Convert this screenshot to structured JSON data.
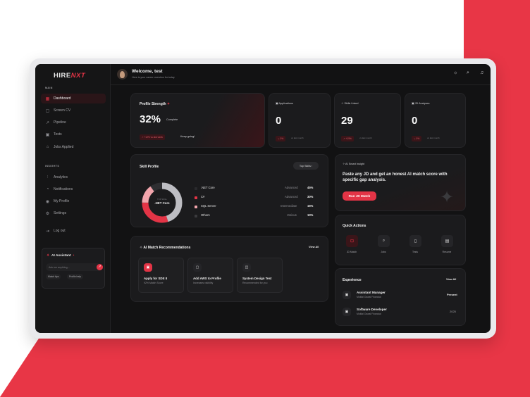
{
  "brand": {
    "logo_a": "HIRE",
    "logo_b": "NXT",
    "accent": "#e33446"
  },
  "header": {
    "welcome": "Welcome, test",
    "subtitle": "Here is your career overview for today"
  },
  "sidebar": {
    "section_main": "MAIN",
    "section_insights": "INSIGHTS",
    "items": [
      {
        "label": "Dashboard",
        "icon": "grid-icon"
      },
      {
        "label": "Screen CV",
        "icon": "document-icon"
      },
      {
        "label": "Pipeline",
        "icon": "trend-icon"
      },
      {
        "label": "Tests",
        "icon": "clipboard-icon"
      },
      {
        "label": "Jobs Applied",
        "icon": "bank-icon"
      },
      {
        "label": "Analytics",
        "icon": "bars-icon"
      },
      {
        "label": "Notifications",
        "icon": "bell-icon"
      },
      {
        "label": "My Profile",
        "icon": "user-icon"
      },
      {
        "label": "Settings",
        "icon": "gear-icon"
      },
      {
        "label": "Log out",
        "icon": "logout-icon"
      }
    ],
    "assistant": {
      "title": "AI Assistant",
      "placeholder": "Ask me anything...",
      "chip_a": "Match tips",
      "chip_b": "Profile help"
    }
  },
  "profile": {
    "title": "Profile Strength",
    "percent": "32%",
    "complete": "Complete",
    "delta": "↗ +12% vs last week",
    "note": "Keep going!"
  },
  "stats": [
    {
      "label": "Applications",
      "value": "0",
      "pill": "↘ 0%",
      "note": "vs last month"
    },
    {
      "label": "Skills Listed",
      "value": "29",
      "pill": "↗ +19%",
      "note": "vs last month"
    },
    {
      "label": "JD Analyses",
      "value": "0",
      "pill": "↘ 0%",
      "note": "vs last month"
    }
  ],
  "skill": {
    "title": "Skill Profile",
    "button": "Top Skills",
    "donut_top": "TOP SKILL",
    "donut_label": ".NET Core",
    "rows": [
      {
        "name": ".NET Core",
        "level": "Advanced",
        "pct": "45%",
        "color": "#2a2a2d"
      },
      {
        "name": "C#",
        "level": "Advanced",
        "pct": "30%",
        "color": "#e33446"
      },
      {
        "name": "SQL Server",
        "level": "Intermediate",
        "pct": "15%",
        "color": "#f2a5ac"
      },
      {
        "name": "Others",
        "level": "Various",
        "pct": "10%",
        "color": "#3a3a3d"
      }
    ]
  },
  "insight": {
    "label": "AI Smart Insight",
    "text": "Paste any JD and get an honest AI match score with specific gap analysis.",
    "button": "Run JD Match"
  },
  "quick": {
    "title": "Quick Actions",
    "items": [
      "JD Match",
      "Jobs",
      "Tests",
      "Resume"
    ]
  },
  "recs": {
    "title": "AI Match Recommendations",
    "view_all": "View All",
    "items": [
      {
        "title": "Apply for SDE II",
        "sub": "92% Match Score"
      },
      {
        "title": "Add AWS to Profile",
        "sub": "Increases visibility"
      },
      {
        "title": "System Design Test",
        "sub": "Recommended for you"
      }
    ]
  },
  "experience": {
    "title": "Experience",
    "view_all": "View All",
    "items": [
      {
        "role": "Assistant Manager",
        "company": "Motilal Oswal Financial",
        "when": "Present"
      },
      {
        "role": "Software Developer",
        "company": "Motilal Oswal Financial",
        "when": "2025"
      }
    ]
  }
}
